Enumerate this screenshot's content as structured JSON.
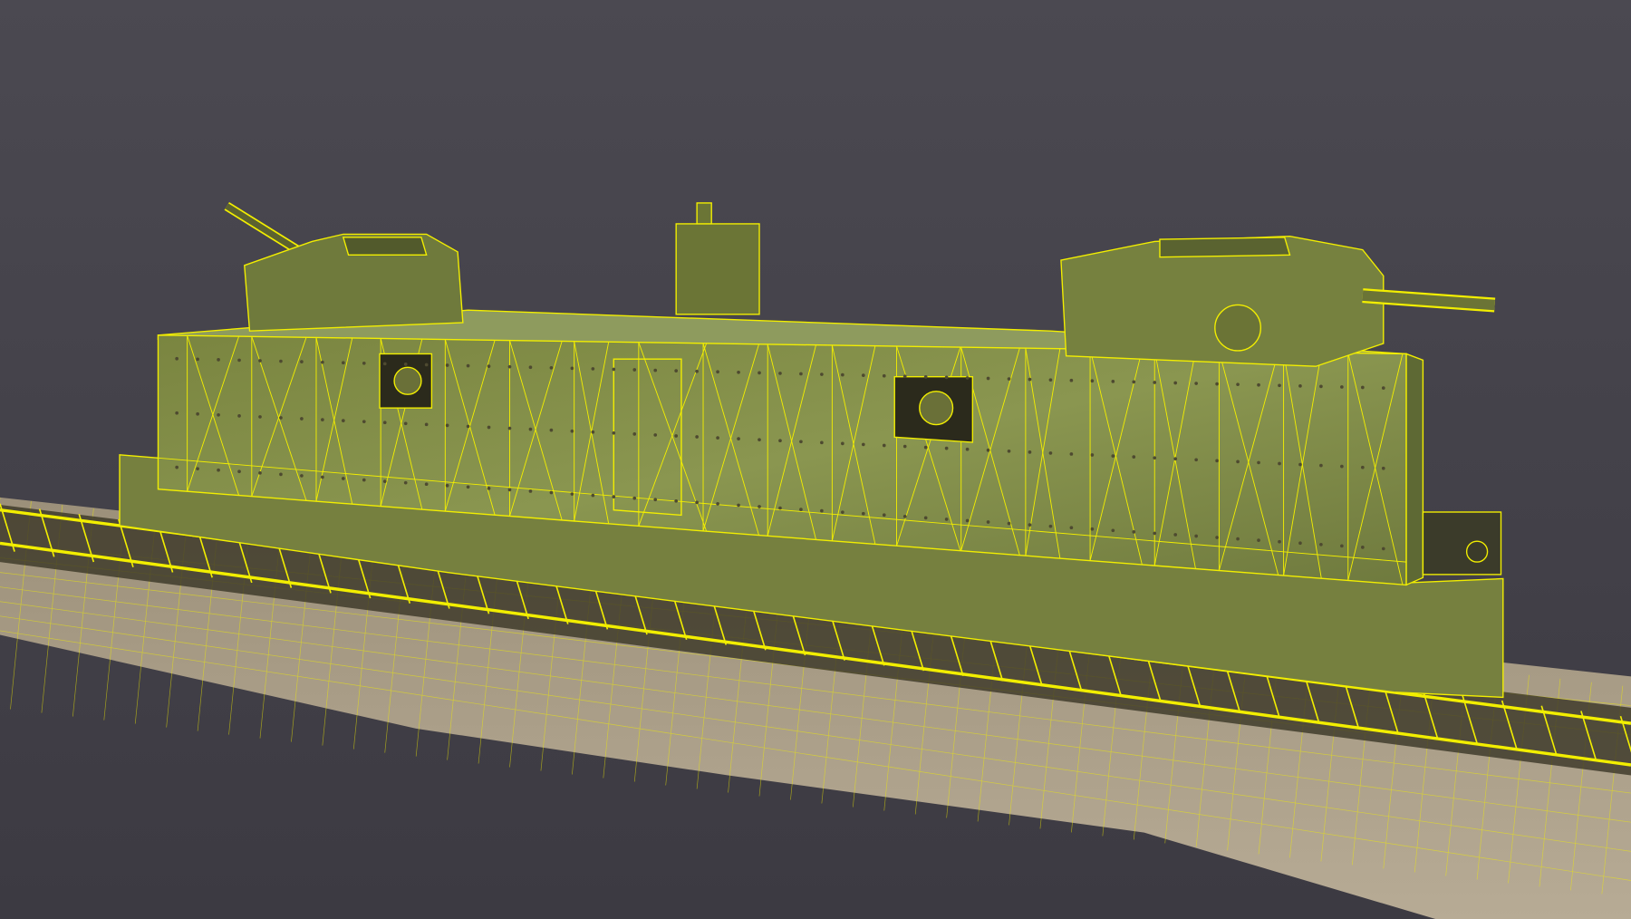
{
  "colors": {
    "background_top": "#4b4951",
    "background_bottom": "#3c3a42",
    "wireframe": "#f2ee00",
    "armor": "#7f8c45",
    "armor_dark": "#5a6230",
    "gravel": "#a69a85",
    "port": "#2b2a1c"
  }
}
